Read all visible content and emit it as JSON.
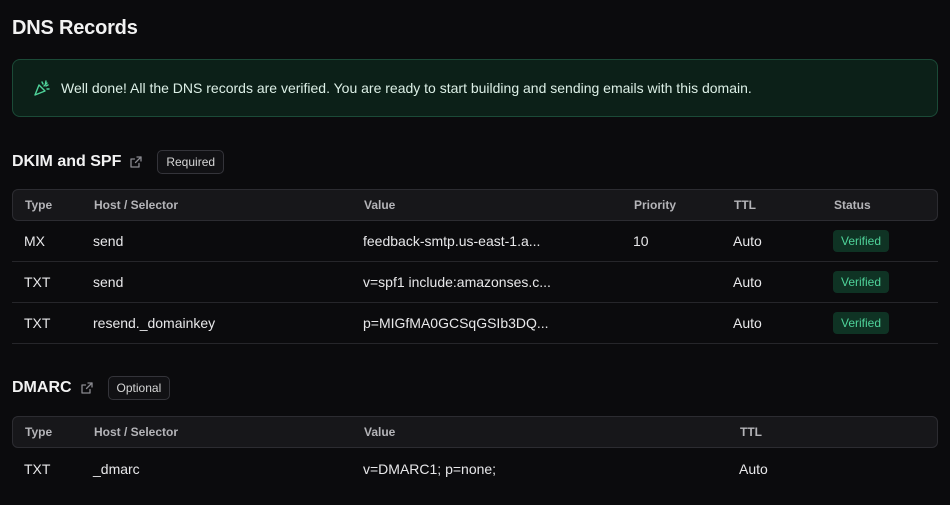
{
  "page": {
    "title": "DNS Records"
  },
  "banner": {
    "icon": "party-popper-icon",
    "text": "Well done! All the DNS records are verified. You are ready to start building and sending emails with this domain."
  },
  "dkim": {
    "title": "DKIM and SPF",
    "tag": "Required",
    "headers": {
      "type": "Type",
      "host": "Host / Selector",
      "value": "Value",
      "priority": "Priority",
      "ttl": "TTL",
      "status": "Status"
    },
    "rows": [
      {
        "type": "MX",
        "host": "send",
        "value": "feedback-smtp.us-east-1.a...",
        "priority": "10",
        "ttl": "Auto",
        "status": "Verified"
      },
      {
        "type": "TXT",
        "host": "send",
        "value": "v=spf1 include:amazonses.c...",
        "priority": "",
        "ttl": "Auto",
        "status": "Verified"
      },
      {
        "type": "TXT",
        "host": "resend._domainkey",
        "value": "p=MIGfMA0GCSqGSIb3DQ...",
        "priority": "",
        "ttl": "Auto",
        "status": "Verified"
      }
    ]
  },
  "dmarc": {
    "title": "DMARC",
    "tag": "Optional",
    "headers": {
      "type": "Type",
      "host": "Host / Selector",
      "value": "Value",
      "ttl": "TTL"
    },
    "rows": [
      {
        "type": "TXT",
        "host": "_dmarc",
        "value": "v=DMARC1; p=none;",
        "ttl": "Auto"
      }
    ]
  },
  "colors": {
    "accent_green": "#4fd39a",
    "banner_bg": "#0c2018",
    "banner_border": "#1b4a37"
  }
}
